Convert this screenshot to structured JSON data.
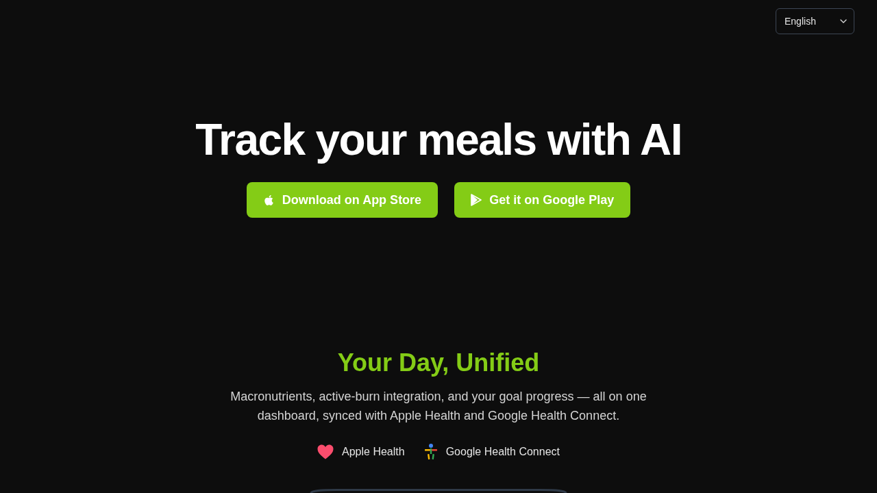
{
  "language_select": {
    "value": "English"
  },
  "hero": {
    "title": "Track your meals with AI",
    "buttons": [
      {
        "kind": "app_store",
        "label": "Download on App Store"
      },
      {
        "kind": "google_play",
        "label": "Get it on Google Play"
      }
    ]
  },
  "feature": {
    "title": "Your Day, Unified",
    "description": "Macronutrients, active-burn integration, and your goal progress — all on one dashboard, synced with Apple Health and Google Health Connect.",
    "integrations": [
      {
        "kind": "apple_health",
        "label": "Apple Health"
      },
      {
        "kind": "google_health_connect",
        "label": "Google Health Connect"
      }
    ]
  }
}
